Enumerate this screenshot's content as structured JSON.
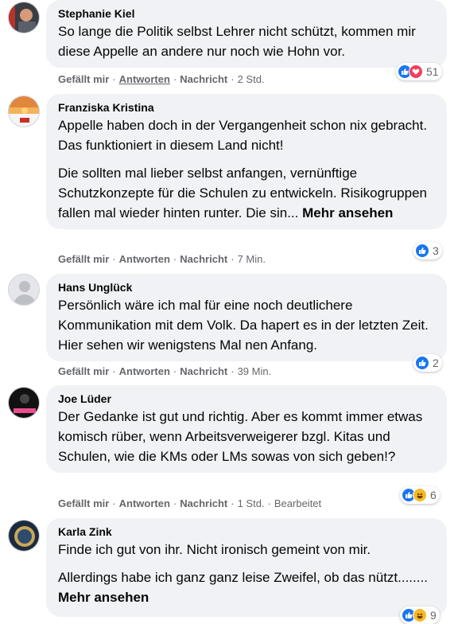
{
  "colors": {
    "like": "#1877f2",
    "love": "#f33e58",
    "haha": "#f7b928",
    "meta": "#65676b",
    "bubble": "#f0f2f5"
  },
  "actions": {
    "like": "Gefällt mir",
    "reply": "Antworten",
    "message": "Nachricht",
    "dot": "·"
  },
  "comments": [
    {
      "author": "Stephanie Kiel",
      "paragraphs": [
        "So lange die Politik selbst Lehrer nicht schützt, kommen mir diese Appelle an andere nur noch wie Hohn vor."
      ],
      "more": "",
      "time": "2 Std.",
      "edited": "",
      "reactions": [
        "like-icon",
        "love-icon"
      ],
      "reaction_count": "51"
    },
    {
      "author": "Franziska Kristina",
      "paragraphs": [
        "Appelle haben doch in der Vergangenheit schon nix gebracht. Das funktioniert in diesem Land nicht!",
        "Die sollten mal lieber selbst anfangen, vernünftige Schutzkonzepte für die Schulen zu entwickeln. Risikogruppen fallen mal wieder hinten runter. Die sin..."
      ],
      "more": "Mehr ansehen",
      "time": "7 Min.",
      "edited": "",
      "reactions": [
        "like-icon"
      ],
      "reaction_count": "3"
    },
    {
      "author": "Hans Unglück",
      "paragraphs": [
        "Persönlich wäre ich mal für eine noch deutlichere Kommunikation mit dem Volk. Da hapert es in der letzten Zeit. Hier sehen wir wenigstens Mal nen Anfang."
      ],
      "more": "",
      "time": "39 Min.",
      "edited": "",
      "reactions": [
        "like-icon"
      ],
      "reaction_count": "2"
    },
    {
      "author": "Joe Lüder",
      "paragraphs": [
        "Der Gedanke ist gut und richtig. Aber es kommt immer etwas komisch rüber, wenn Arbeitsverweigerer bzgl. Kitas und Schulen, wie die KMs oder LMs sowas von sich geben!?"
      ],
      "more": "",
      "time": "1 Std.",
      "edited": "Bearbeitet",
      "reactions": [
        "like-icon",
        "haha-icon"
      ],
      "reaction_count": "6"
    },
    {
      "author": "Karla Zink",
      "paragraphs": [
        "Finde ich gut von ihr. Nicht ironisch gemeint von mir.",
        "Allerdings habe ich ganz ganz leise Zweifel, ob das nützt........"
      ],
      "more": "Mehr ansehen",
      "time": "",
      "edited": "",
      "reactions": [
        "like-icon",
        "haha-icon"
      ],
      "reaction_count": "9"
    }
  ]
}
